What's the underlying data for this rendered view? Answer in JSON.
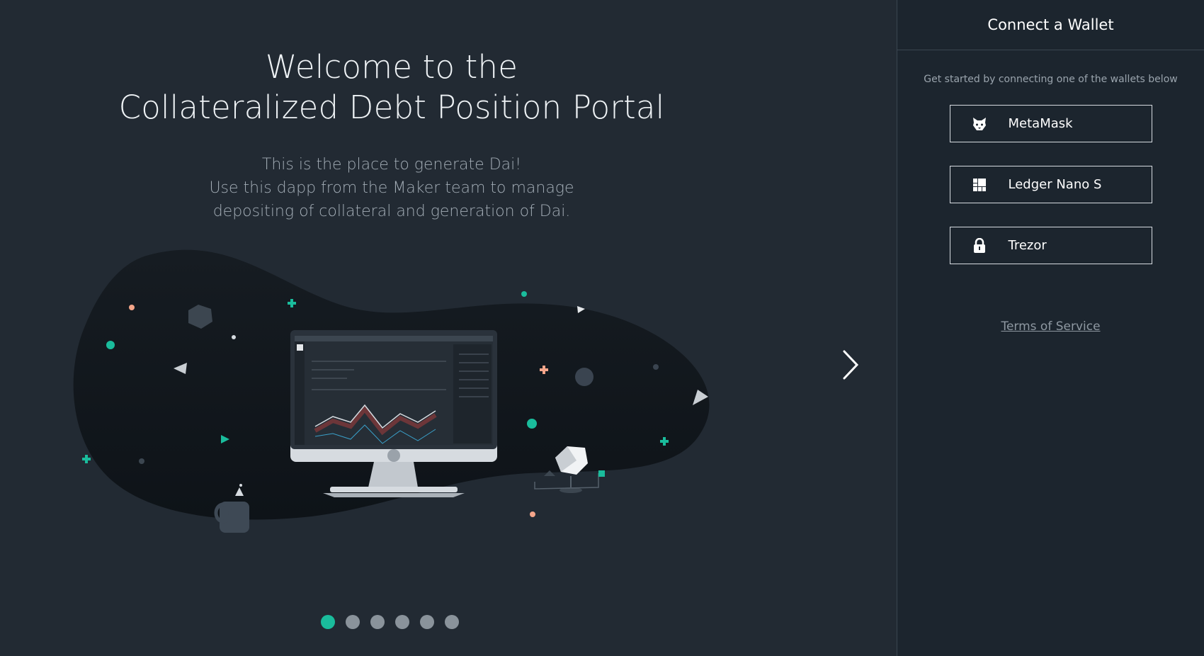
{
  "hero": {
    "title_line1": "Welcome to the",
    "title_line2": "Collateralized Debt Position Portal",
    "subtitle_line1": "This is the place to generate Dai!",
    "subtitle_line2": "Use this dapp from the Maker team to manage",
    "subtitle_line3": "depositing of collateral and generation of Dai."
  },
  "carousel": {
    "slide_count": 6,
    "active_index": 0,
    "next_icon": "chevron-right-icon"
  },
  "panel": {
    "title": "Connect a Wallet",
    "intro": "Get started by connecting one of the wallets below",
    "wallets": [
      {
        "label": "MetaMask",
        "icon": "metamask-fox-icon"
      },
      {
        "label": "Ledger Nano S",
        "icon": "ledger-icon"
      },
      {
        "label": "Trezor",
        "icon": "lock-icon"
      }
    ],
    "terms_label": "Terms of Service"
  },
  "colors": {
    "accent": "#1abc9c",
    "background": "#222a33",
    "panel_background": "#1c252e",
    "coral": "#f4a58a"
  }
}
